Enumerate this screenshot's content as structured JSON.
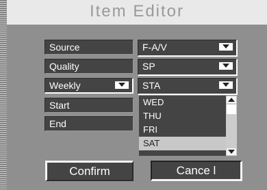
{
  "title": "Item Editor",
  "labels": {
    "source": "Source",
    "quality": "Quality",
    "weekly": "Weekly",
    "start": "Start",
    "end": "End"
  },
  "values": {
    "source": "F-A/V",
    "quality": "SP",
    "weekly": "STA"
  },
  "day_list": [
    "WED",
    "THU",
    "FRI",
    "SAT"
  ],
  "day_list_highlighted": "SAT",
  "buttons": {
    "confirm": "Confirm",
    "cancel": "Cance l"
  },
  "colors": {
    "background": "#8f8f8f",
    "field": "#444444",
    "title_bar": "#e9e9e9",
    "title_text": "#9a9a9a",
    "highlight": "#c8c8c8"
  }
}
